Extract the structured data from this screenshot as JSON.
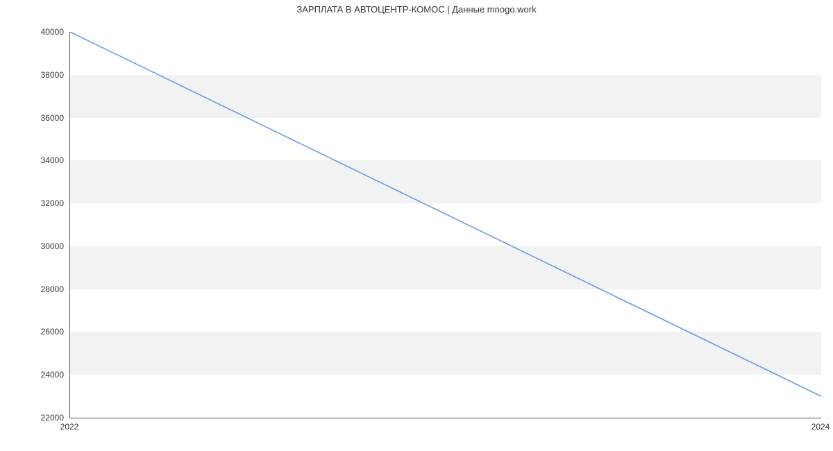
{
  "chart_data": {
    "type": "line",
    "title": "ЗАРПЛАТА В АВТОЦЕНТР-КОМОС | Данные mnogo.work",
    "xlabel": "",
    "ylabel": "",
    "x": [
      2022,
      2024
    ],
    "values": [
      40000,
      23000
    ],
    "x_ticks": [
      2022,
      2024
    ],
    "y_ticks": [
      22000,
      24000,
      26000,
      28000,
      30000,
      32000,
      34000,
      36000,
      38000,
      40000
    ],
    "xlim": [
      2022,
      2024
    ],
    "ylim": [
      22000,
      40000
    ],
    "line_color": "#6a99e8",
    "band_color": "#f2f2f2"
  }
}
